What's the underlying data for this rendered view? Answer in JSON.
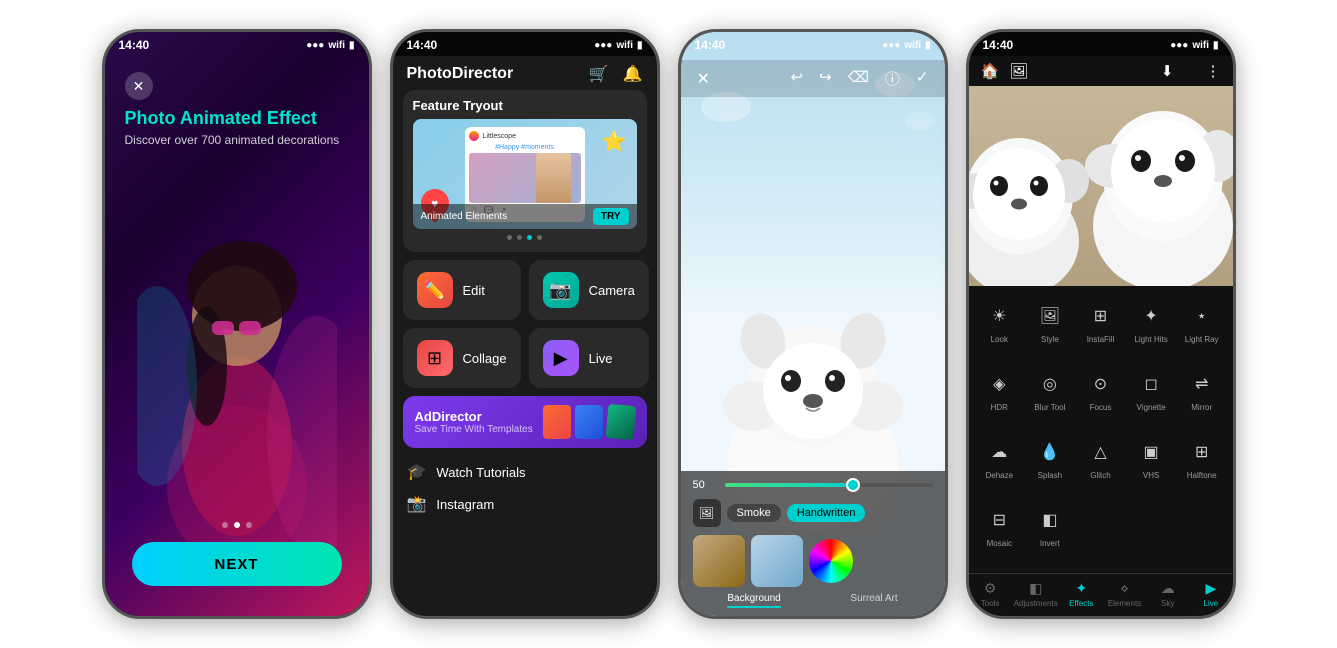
{
  "phone1": {
    "status_time": "14:40",
    "title": "Photo Animated Effect",
    "subtitle": "Discover over 700 animated decorations",
    "next_button": "NEXT",
    "dots": [
      false,
      true,
      false
    ]
  },
  "phone2": {
    "status_time": "14:40",
    "logo": "PhotoDirector",
    "feature_title": "Feature Tryout",
    "hashtag": "#Happy #moments",
    "username": "Littlescope",
    "animated_label": "Animated Elements",
    "try_button": "TRY",
    "buttons": [
      {
        "label": "Edit",
        "icon": "✏️"
      },
      {
        "label": "Camera",
        "icon": "📷"
      },
      {
        "label": "Collage",
        "icon": "⊞"
      },
      {
        "label": "Live",
        "icon": "▶"
      }
    ],
    "ad_title": "AdDirector",
    "ad_subtitle": "Save Time With Templates",
    "watch_label": "Watch Tutorials",
    "instagram_label": "Instagram"
  },
  "phone3": {
    "status_time": "14:40",
    "slider_value": "50",
    "smoke_label": "Smoke",
    "handwritten_chip": "Handwritten",
    "bottom_labels": [
      "Background",
      "Surreal Art"
    ]
  },
  "phone4": {
    "status_time": "14:40",
    "tools": [
      {
        "label": "Look",
        "icon": "☀"
      },
      {
        "label": "Style",
        "icon": "🖼"
      },
      {
        "label": "InstaFill",
        "icon": "⊞"
      },
      {
        "label": "Light Hits",
        "icon": "✦"
      },
      {
        "label": "Light Ray",
        "icon": "⋆"
      },
      {
        "label": "HDR",
        "icon": "◈"
      },
      {
        "label": "Blur Tool",
        "icon": "◎"
      },
      {
        "label": "Focus",
        "icon": "⊙"
      },
      {
        "label": "Vignette",
        "icon": "◻"
      },
      {
        "label": "Mirror",
        "icon": "⇌"
      },
      {
        "label": "Dehaze",
        "icon": "☁"
      },
      {
        "label": "Splash",
        "icon": "✦"
      },
      {
        "label": "Glitch",
        "icon": "△"
      },
      {
        "label": "VHS",
        "icon": "▣"
      },
      {
        "label": "Halftone",
        "icon": "⊞"
      },
      {
        "label": "Mosaic",
        "icon": "⊟"
      },
      {
        "label": "Invert",
        "icon": "◧"
      }
    ],
    "nav_items": [
      {
        "label": "Tools",
        "icon": "⚙"
      },
      {
        "label": "Adjustments",
        "icon": "◧"
      },
      {
        "label": "Effects",
        "icon": "✦"
      },
      {
        "label": "Elements",
        "icon": "⋄"
      },
      {
        "label": "Sky",
        "icon": "☁"
      },
      {
        "label": "Live",
        "icon": "▶"
      }
    ]
  }
}
